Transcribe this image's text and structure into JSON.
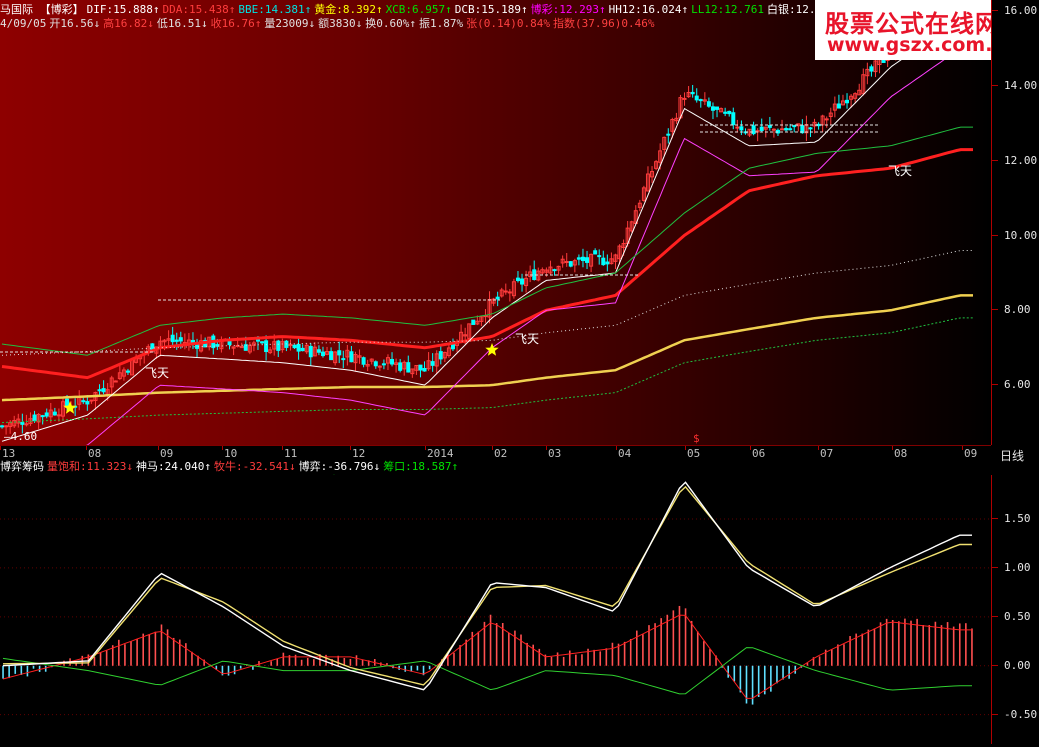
{
  "header": {
    "line1": [
      {
        "text": "马国际 【博彩】",
        "color": "#ffffff"
      },
      {
        "text": "DIF:15.888↑",
        "color": "#ffffff"
      },
      {
        "text": "DDA:15.438↑",
        "color": "#ff3c3c"
      },
      {
        "text": "BBE:14.381↑",
        "color": "#00e0e0"
      },
      {
        "text": "黄金:8.392↑",
        "color": "#ffff00"
      },
      {
        "text": "XCB:6.957↑",
        "color": "#00e000"
      },
      {
        "text": "DCB:15.189↑",
        "color": "#ffffff"
      },
      {
        "text": "博彩:12.293↑",
        "color": "#ff00ff"
      },
      {
        "text": "HH12:16.024↑",
        "color": "#ffffff"
      },
      {
        "text": "LL12:12.761",
        "color": "#00e000"
      },
      {
        "text": "白银:12.823",
        "color": "#ffffff"
      }
    ],
    "line2": [
      {
        "text": "4/09/05",
        "color": "#e0e0e0"
      },
      {
        "text": "开16.56↓",
        "color": "#e0e0e0"
      },
      {
        "text": "高16.82↓",
        "color": "#ff4040"
      },
      {
        "text": "低16.51↓",
        "color": "#e0e0e0"
      },
      {
        "text": "收16.76↑",
        "color": "#ff4040"
      },
      {
        "text": "量23009↓",
        "color": "#e0e0e0"
      },
      {
        "text": "额3830↓",
        "color": "#e0e0e0"
      },
      {
        "text": "换0.60%↑",
        "color": "#e0e0e0"
      },
      {
        "text": "振1.87%",
        "color": "#e0e0e0"
      },
      {
        "text": "张(0.14)0.84%",
        "color": "#ff4040"
      },
      {
        "text": "指数(37.96)0.46%",
        "color": "#ff4040"
      }
    ]
  },
  "watermark": {
    "title": "股票公式在线网",
    "url": "www.gszx.com.cn"
  },
  "price_axis": {
    "ticks": [
      "16.00",
      "14.00",
      "12.00",
      "10.00",
      "8.00",
      "6.00"
    ]
  },
  "xaxis": {
    "labels": [
      "13",
      "08",
      "09",
      "10",
      "11",
      "12",
      "2014",
      "02",
      "03",
      "04",
      "05",
      "06",
      "07",
      "08",
      "09"
    ],
    "marker": "$",
    "period": "日线"
  },
  "lowest_label": "4.60",
  "annotations": {
    "fly": "飞天"
  },
  "mid_header": {
    "line1": [
      {
        "text": "博弈筹码",
        "color": "#ffffff"
      },
      {
        "text": "量饱和:11.323↓",
        "color": "#ff3c3c"
      },
      {
        "text": "神马:24.040↑",
        "color": "#ffffff"
      },
      {
        "text": "牧牛:-32.541↓",
        "color": "#ff3c3c"
      },
      {
        "text": "博弈:-36.796↓",
        "color": "#ffffff"
      },
      {
        "text": "筹口:18.587↑",
        "color": "#00e000"
      }
    ],
    "line2": [
      {
        "text": "飞雁",
        "color": "#ffffff"
      },
      {
        "text": "MACD:0.407↓",
        "color": "#ff3c3c"
      },
      {
        "text": "DIFF:1.335↑",
        "color": "#ffffff"
      },
      {
        "text": "DEAD:1.239↑",
        "color": "#ffffff"
      },
      {
        "text": "DMAC:0.193↓",
        "color": "#ff00ff"
      },
      {
        "text": "南飞雁:-0.193↑",
        "color": "#00e000"
      }
    ]
  },
  "macd_axis": {
    "ticks": [
      "1.50",
      "1.00",
      "0.50",
      "0.00",
      "-0.50"
    ]
  },
  "chart_data": [
    {
      "type": "line",
      "title": "",
      "xlabel": "",
      "ylabel": "",
      "ylim": [
        4.4,
        16.3
      ],
      "x": [
        "13",
        "08",
        "09",
        "10",
        "11",
        "12",
        "2014",
        "02",
        "03",
        "04",
        "05",
        "06",
        "07",
        "08",
        "09"
      ],
      "series": [
        {
          "name": "close",
          "values": [
            4.9,
            5.6,
            7.2,
            7.1,
            7.0,
            6.8,
            6.4,
            8.2,
            9.2,
            9.4,
            13.8,
            12.8,
            12.9,
            14.9,
            16.2
          ]
        },
        {
          "name": "MA long",
          "values": [
            5.6,
            5.7,
            5.8,
            5.85,
            5.9,
            5.95,
            5.95,
            6.0,
            6.2,
            6.4,
            7.2,
            7.5,
            7.8,
            8.0,
            8.4
          ]
        },
        {
          "name": "MA mid",
          "values": [
            6.5,
            6.2,
            7.0,
            7.2,
            7.3,
            7.2,
            7.0,
            7.3,
            8.0,
            8.4,
            10.0,
            11.2,
            11.6,
            11.8,
            12.3
          ]
        }
      ]
    },
    {
      "type": "line",
      "title": "",
      "ylim": [
        -0.8,
        1.95
      ],
      "series": [
        {
          "name": "DIFF",
          "values": [
            0.0,
            0.05,
            0.95,
            0.6,
            0.2,
            -0.05,
            -0.25,
            0.85,
            0.8,
            0.55,
            1.9,
            1.0,
            0.6,
            1.0,
            1.335
          ]
        },
        {
          "name": "DEAD",
          "values": [
            0.02,
            0.03,
            0.9,
            0.65,
            0.25,
            -0.02,
            -0.2,
            0.8,
            0.82,
            0.6,
            1.85,
            1.05,
            0.62,
            0.95,
            1.239
          ]
        },
        {
          "name": "MACD",
          "values": [
            -0.15,
            0.1,
            0.4,
            -0.1,
            0.1,
            0.1,
            -0.1,
            0.5,
            0.1,
            0.2,
            0.6,
            -0.4,
            0.1,
            0.5,
            0.407
          ]
        }
      ]
    }
  ]
}
